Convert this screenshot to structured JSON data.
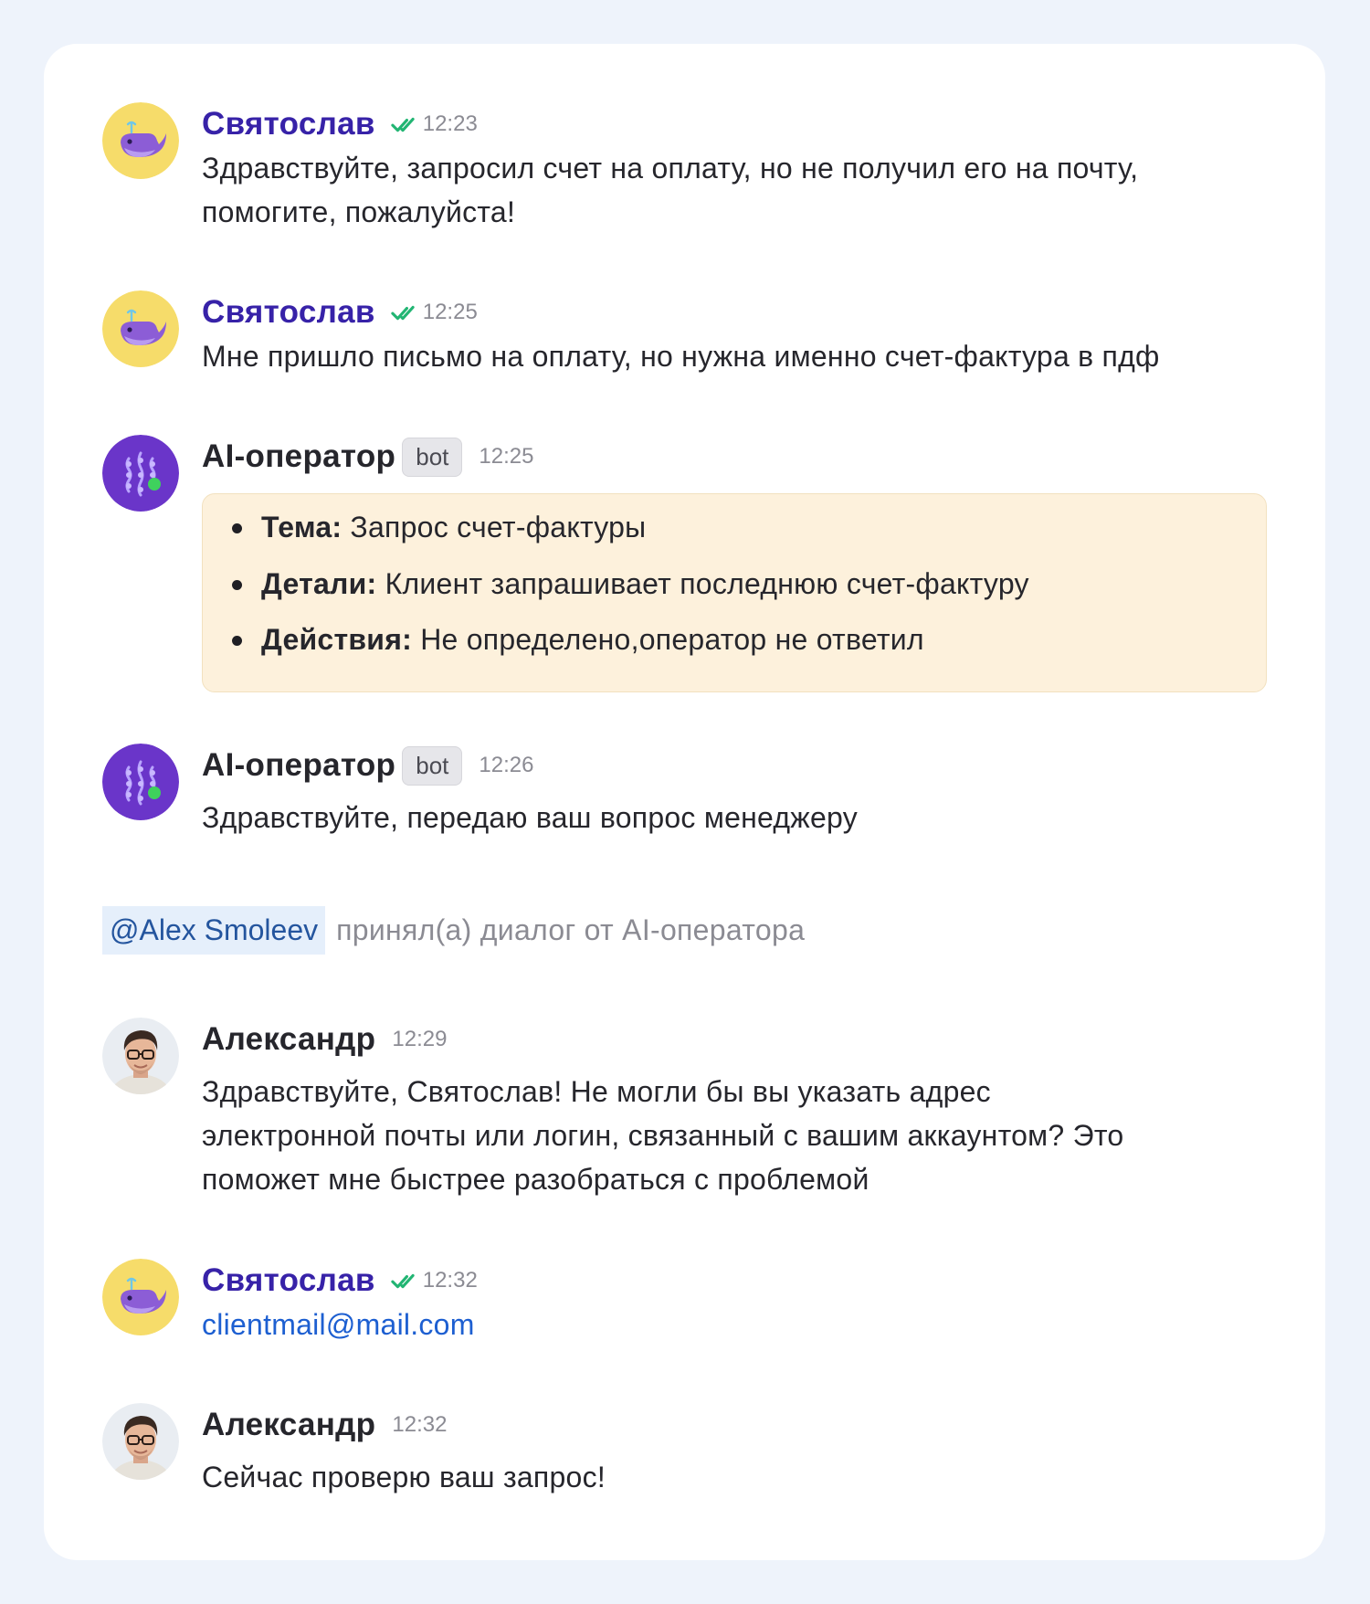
{
  "messages": [
    {
      "author": "Святослав",
      "time": "12:23",
      "text": "Здравствуйте, запросил счет на оплату, но не получил его на почту, помогите, пожалуйста!"
    },
    {
      "author": "Святослав",
      "time": "12:25",
      "text": "Мне пришло письмо на оплату, но нужна именно счет-фактура в пдф"
    },
    {
      "author": "AI-оператор",
      "badge": "bot",
      "time": "12:25",
      "summary": [
        {
          "label": "Тема:",
          "value": "Запрос счет-фактуры"
        },
        {
          "label": "Детали:",
          "value": "Клиент запрашивает последнюю счет-фактуру"
        },
        {
          "label": "Действия:",
          "value": "Не определено,оператор не ответил"
        }
      ]
    },
    {
      "author": "AI-оператор",
      "badge": "bot",
      "time": "12:26",
      "text": "Здравствуйте, передаю ваш вопрос менеджеру"
    },
    {
      "author": "Александр",
      "time": "12:29",
      "lines": [
        "Здравствуйте, Святослав! Не могли бы вы указать адрес",
        "электронной почты или логин, связанный с вашим аккаунтом? Это",
        "поможет мне быстрее разобраться с проблемой"
      ]
    },
    {
      "author": "Святослав",
      "time": "12:32",
      "text": "clientmail@mail.com"
    },
    {
      "author": "Александр",
      "time": "12:32",
      "text": "Сейчас проверю ваш запрос!"
    }
  ],
  "event": {
    "mention": "@Alex Smoleev",
    "text": "принял(а) диалог от AI-оператора"
  },
  "colors": {
    "client_name": "#3722a8",
    "read_check": "#22b573",
    "link": "#1d5fd1",
    "summary_bg": "#fdf1dc",
    "ai_avatar": "#6a35c9",
    "client_avatar": "#f6dc6a"
  }
}
